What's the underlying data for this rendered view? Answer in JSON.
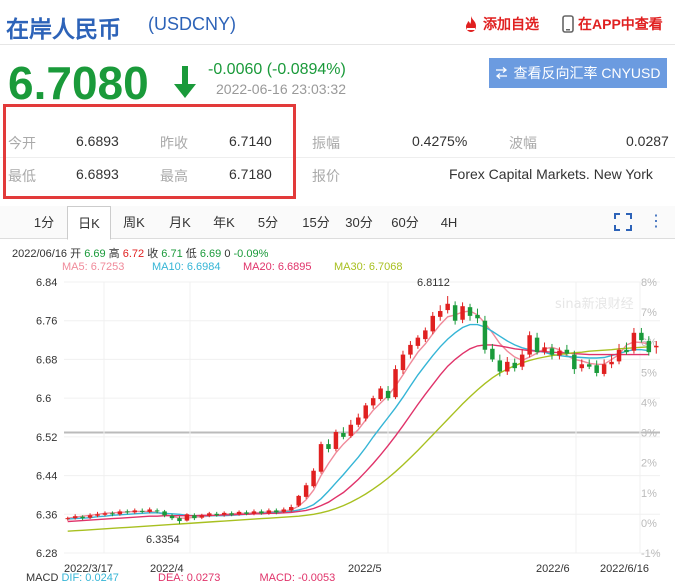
{
  "header": {
    "title": "在岸人民币",
    "symbol": "(USDCNY)",
    "add_watch": "添加自选",
    "open_app": "在APP中查看"
  },
  "quote": {
    "price": "6.7080",
    "change": "-0.0060 (-0.0894%)",
    "timestamp": "2022-06-16 23:03:32",
    "reverse_btn": "查看反向汇率 CNYUSD"
  },
  "stats": {
    "open_label": "今开",
    "open": "6.6893",
    "prev_label": "昨收",
    "prev": "6.7140",
    "amp_label": "振幅",
    "amp": "0.4275%",
    "wave_label": "波幅",
    "wave": "0.0287",
    "low_label": "最低",
    "low": "6.6893",
    "high_label": "最高",
    "high": "6.7180",
    "quote_label": "报价",
    "quote_src": "Forex Capital Markets. New York"
  },
  "tabs": [
    "1分",
    "日K",
    "周K",
    "月K",
    "年K",
    "5分",
    "15分",
    "30分",
    "60分",
    "4H"
  ],
  "active_tab": "日K",
  "kline_info": {
    "date": "2022/06/16",
    "open_label": "开",
    "open": "6.69",
    "high_label": "高",
    "high": "6.72",
    "close_label": "收",
    "close": "6.71",
    "low_label": "低",
    "low": "6.69",
    "vol": "0",
    "pct": "-0.09%"
  },
  "ma_legend": [
    {
      "label": "MA5: 6.7253",
      "color": "#f08a9a"
    },
    {
      "label": "MA10: 6.6984",
      "color": "#35b5d6"
    },
    {
      "label": "MA20: 6.6895",
      "color": "#e0336a"
    },
    {
      "label": "MA30: 6.7068",
      "color": "#a8c020"
    }
  ],
  "watermark": "sina新浪财经",
  "chart_data": {
    "type": "candlestick",
    "y_ticks": [
      "6.84",
      "6.76",
      "6.68",
      "6.6",
      "6.52",
      "6.44",
      "6.36",
      "6.28"
    ],
    "pct_ticks": [
      "8%",
      "7%",
      "6%",
      "5%",
      "4%",
      "3%",
      "2%",
      "1%",
      "0%",
      "-1%"
    ],
    "x_ticks": [
      "2022/3/17",
      "2022/4",
      "2022/5",
      "2022/6",
      "2022/6/16"
    ],
    "ylim": [
      6.28,
      6.84
    ],
    "max_label": "6.8112",
    "min_label": "6.3354",
    "candles": [
      [
        6.35,
        6.352,
        6.355,
        6.347
      ],
      [
        6.352,
        6.356,
        6.36,
        6.349
      ],
      [
        6.355,
        6.352,
        6.358,
        6.348
      ],
      [
        6.353,
        6.358,
        6.362,
        6.35
      ],
      [
        6.357,
        6.36,
        6.365,
        6.354
      ],
      [
        6.359,
        6.362,
        6.366,
        6.356
      ],
      [
        6.362,
        6.36,
        6.366,
        6.356
      ],
      [
        6.36,
        6.366,
        6.37,
        6.357
      ],
      [
        6.366,
        6.364,
        6.37,
        6.36
      ],
      [
        6.364,
        6.368,
        6.372,
        6.361
      ],
      [
        6.367,
        6.365,
        6.372,
        6.362
      ],
      [
        6.365,
        6.37,
        6.374,
        6.362
      ],
      [
        6.368,
        6.366,
        6.372,
        6.362
      ],
      [
        6.366,
        6.358,
        6.369,
        6.354
      ],
      [
        6.357,
        6.352,
        6.361,
        6.348
      ],
      [
        6.352,
        6.346,
        6.356,
        6.34
      ],
      [
        6.347,
        6.36,
        6.362,
        6.345
      ],
      [
        6.358,
        6.352,
        6.362,
        6.348
      ],
      [
        6.353,
        6.358,
        6.361,
        6.35
      ],
      [
        6.357,
        6.362,
        6.365,
        6.354
      ],
      [
        6.361,
        6.358,
        6.365,
        6.355
      ],
      [
        6.359,
        6.363,
        6.366,
        6.355
      ],
      [
        6.362,
        6.359,
        6.366,
        6.356
      ],
      [
        6.36,
        6.365,
        6.368,
        6.357
      ],
      [
        6.364,
        6.361,
        6.368,
        6.358
      ],
      [
        6.361,
        6.366,
        6.37,
        6.358
      ],
      [
        6.366,
        6.362,
        6.37,
        6.359
      ],
      [
        6.362,
        6.368,
        6.372,
        6.359
      ],
      [
        6.368,
        6.364,
        6.372,
        6.36
      ],
      [
        6.365,
        6.37,
        6.374,
        6.362
      ],
      [
        6.368,
        6.375,
        6.38,
        6.365
      ],
      [
        6.378,
        6.398,
        6.4,
        6.375
      ],
      [
        6.396,
        6.42,
        6.425,
        6.392
      ],
      [
        6.418,
        6.45,
        6.455,
        6.415
      ],
      [
        6.448,
        6.505,
        6.51,
        6.444
      ],
      [
        6.505,
        6.495,
        6.515,
        6.488
      ],
      [
        6.495,
        6.53,
        6.535,
        6.49
      ],
      [
        6.528,
        6.52,
        6.54,
        6.515
      ],
      [
        6.522,
        6.545,
        6.555,
        6.518
      ],
      [
        6.545,
        6.56,
        6.568,
        6.54
      ],
      [
        6.558,
        6.585,
        6.59,
        6.552
      ],
      [
        6.585,
        6.6,
        6.605,
        6.578
      ],
      [
        6.598,
        6.62,
        6.625,
        6.594
      ],
      [
        6.615,
        6.6,
        6.625,
        6.595
      ],
      [
        6.602,
        6.66,
        6.668,
        6.598
      ],
      [
        6.658,
        6.69,
        6.698,
        6.65
      ],
      [
        6.69,
        6.71,
        6.718,
        6.682
      ],
      [
        6.708,
        6.725,
        6.73,
        6.702
      ],
      [
        6.722,
        6.74,
        6.746,
        6.716
      ],
      [
        6.738,
        6.77,
        6.778,
        6.732
      ],
      [
        6.768,
        6.78,
        6.792,
        6.76
      ],
      [
        6.782,
        6.795,
        6.811,
        6.775
      ],
      [
        6.792,
        6.76,
        6.8,
        6.752
      ],
      [
        6.762,
        6.79,
        6.798,
        6.755
      ],
      [
        6.788,
        6.77,
        6.795,
        6.76
      ],
      [
        6.772,
        6.765,
        6.785,
        6.755
      ],
      [
        6.76,
        6.7,
        6.77,
        6.692
      ],
      [
        6.702,
        6.68,
        6.712,
        6.675
      ],
      [
        6.678,
        6.655,
        6.69,
        6.645
      ],
      [
        6.655,
        6.675,
        6.685,
        6.648
      ],
      [
        6.673,
        6.662,
        6.682,
        6.655
      ],
      [
        6.665,
        6.69,
        6.7,
        6.658
      ],
      [
        6.69,
        6.73,
        6.738,
        6.684
      ],
      [
        6.725,
        6.695,
        6.735,
        6.69
      ],
      [
        6.696,
        6.705,
        6.715,
        6.69
      ],
      [
        6.703,
        6.69,
        6.712,
        6.68
      ],
      [
        6.688,
        6.698,
        6.705,
        6.68
      ],
      [
        6.7,
        6.692,
        6.71,
        6.688
      ],
      [
        6.69,
        6.66,
        6.698,
        6.65
      ],
      [
        6.662,
        6.67,
        6.68,
        6.655
      ],
      [
        6.67,
        6.665,
        6.68,
        6.66
      ],
      [
        6.668,
        6.652,
        6.678,
        6.645
      ],
      [
        6.65,
        6.67,
        6.68,
        6.645
      ],
      [
        6.67,
        6.675,
        6.69,
        6.662
      ],
      [
        6.676,
        6.7,
        6.712,
        6.67
      ],
      [
        6.7,
        6.695,
        6.715,
        6.69
      ],
      [
        6.698,
        6.735,
        6.745,
        6.692
      ],
      [
        6.735,
        6.72,
        6.745,
        6.715
      ],
      [
        6.718,
        6.695,
        6.728,
        6.688
      ],
      [
        6.705,
        6.708,
        6.718,
        6.692
      ]
    ],
    "ma": [
      {
        "name": "MA5",
        "color": "#f08a9a",
        "values": [
          6.352,
          6.354,
          6.356,
          6.358,
          6.36,
          6.362,
          6.363,
          6.364,
          6.365,
          6.366,
          6.366,
          6.366,
          6.364,
          6.36,
          6.356,
          6.352,
          6.352,
          6.354,
          6.355,
          6.356,
          6.358,
          6.36,
          6.361,
          6.362,
          6.362,
          6.363,
          6.364,
          6.365,
          6.366,
          6.367,
          6.369,
          6.377,
          6.39,
          6.41,
          6.44,
          6.465,
          6.487,
          6.505,
          6.52,
          6.535,
          6.555,
          6.575,
          6.59,
          6.605,
          6.625,
          6.648,
          6.672,
          6.695,
          6.712,
          6.733,
          6.752,
          6.768,
          6.772,
          6.778,
          6.78,
          6.772,
          6.755,
          6.735,
          6.713,
          6.697,
          6.685,
          6.678,
          6.685,
          6.693,
          6.702,
          6.705,
          6.7,
          6.688,
          6.68,
          6.677,
          6.672,
          6.67,
          6.67,
          6.68,
          6.69,
          6.71,
          6.716,
          6.715,
          6.712
        ]
      },
      {
        "name": "MA10",
        "color": "#35b5d6",
        "values": [
          6.35,
          6.351,
          6.352,
          6.353,
          6.355,
          6.356,
          6.358,
          6.359,
          6.36,
          6.361,
          6.362,
          6.363,
          6.363,
          6.362,
          6.361,
          6.36,
          6.358,
          6.357,
          6.357,
          6.357,
          6.357,
          6.357,
          6.358,
          6.359,
          6.36,
          6.361,
          6.362,
          6.363,
          6.364,
          6.365,
          6.366,
          6.369,
          6.373,
          6.38,
          6.392,
          6.408,
          6.425,
          6.442,
          6.46,
          6.478,
          6.498,
          6.52,
          6.54,
          6.56,
          6.58,
          6.602,
          6.625,
          6.648,
          6.668,
          6.688,
          6.706,
          6.722,
          6.735,
          6.746,
          6.752,
          6.752,
          6.747,
          6.738,
          6.728,
          6.718,
          6.71,
          6.704,
          6.7,
          6.697,
          6.695,
          6.69,
          6.688,
          6.686,
          6.685,
          6.684,
          6.683,
          6.683,
          6.684,
          6.688,
          6.692,
          6.697,
          6.7,
          6.7,
          6.698
        ]
      },
      {
        "name": "MA20",
        "color": "#e0336a",
        "values": [
          6.345,
          6.346,
          6.347,
          6.348,
          6.349,
          6.35,
          6.351,
          6.352,
          6.353,
          6.354,
          6.355,
          6.356,
          6.356,
          6.357,
          6.357,
          6.357,
          6.357,
          6.357,
          6.358,
          6.358,
          6.358,
          6.359,
          6.359,
          6.36,
          6.36,
          6.361,
          6.361,
          6.362,
          6.362,
          6.363,
          6.364,
          6.366,
          6.368,
          6.372,
          6.378,
          6.385,
          6.395,
          6.405,
          6.418,
          6.432,
          6.448,
          6.465,
          6.483,
          6.502,
          6.522,
          6.543,
          6.565,
          6.587,
          6.608,
          6.628,
          6.648,
          6.666,
          6.68,
          6.692,
          6.702,
          6.708,
          6.71,
          6.71,
          6.708,
          6.705,
          6.702,
          6.7,
          6.698,
          6.697,
          6.696,
          6.695,
          6.694,
          6.693,
          6.692,
          6.691,
          6.69,
          6.69,
          6.69,
          6.69,
          6.69,
          6.69,
          6.69,
          6.69,
          6.69
        ]
      },
      {
        "name": "MA30",
        "color": "#a8c020",
        "values": [
          6.325,
          6.326,
          6.327,
          6.328,
          6.329,
          6.33,
          6.331,
          6.332,
          6.333,
          6.334,
          6.335,
          6.336,
          6.337,
          6.338,
          6.339,
          6.34,
          6.341,
          6.342,
          6.343,
          6.344,
          6.345,
          6.346,
          6.347,
          6.348,
          6.349,
          6.35,
          6.351,
          6.352,
          6.353,
          6.354,
          6.355,
          6.356,
          6.358,
          6.36,
          6.363,
          6.367,
          6.372,
          6.378,
          6.385,
          6.393,
          6.402,
          6.412,
          6.423,
          6.435,
          6.448,
          6.462,
          6.477,
          6.492,
          6.508,
          6.524,
          6.54,
          6.556,
          6.572,
          6.588,
          6.603,
          6.617,
          6.63,
          6.642,
          6.652,
          6.66,
          6.667,
          6.673,
          6.678,
          6.682,
          6.685,
          6.688,
          6.69,
          6.692,
          6.694,
          6.695,
          6.697,
          6.698,
          6.699,
          6.7,
          6.702,
          6.703,
          6.704,
          6.705,
          6.706
        ]
      }
    ]
  },
  "macd": {
    "label": "MACD",
    "dif": "DIF: 0.0247",
    "dea": "DEA: 0.0273",
    "macd": "MACD: -0.0053"
  }
}
